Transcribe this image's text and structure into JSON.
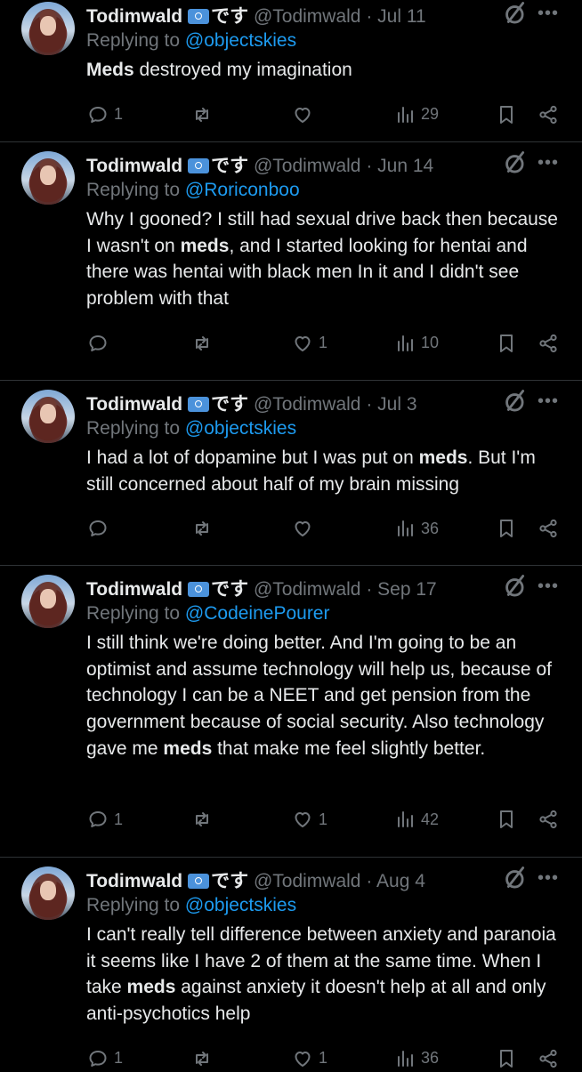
{
  "tweets": [
    {
      "name": "Todimwald",
      "desu": "です",
      "handle": "@Todimwald",
      "date": "Jul 11",
      "replying_label": "Replying to",
      "replying_to": "@objectskies",
      "segments": [
        "",
        "Meds",
        " destroyed my imagination"
      ],
      "replies": "1",
      "retweets": "",
      "likes": "",
      "views": "29"
    },
    {
      "name": "Todimwald",
      "desu": "です",
      "handle": "@Todimwald",
      "date": "Jun 14",
      "replying_label": "Replying to",
      "replying_to": "@Roriconboo",
      "segments": [
        "Why I gooned? I still had sexual drive back then because I wasn't on ",
        "meds",
        ", and I started looking for hentai and there was hentai with black men In it and I didn't see problem with that"
      ],
      "replies": "",
      "retweets": "",
      "likes": "1",
      "views": "10"
    },
    {
      "name": "Todimwald",
      "desu": "です",
      "handle": "@Todimwald",
      "date": "Jul 3",
      "replying_label": "Replying to",
      "replying_to": "@objectskies",
      "segments": [
        "I had a lot of dopamine but I was put on ",
        "meds",
        ". But I'm still concerned about half of my brain missing"
      ],
      "replies": "",
      "retweets": "",
      "likes": "",
      "views": "36"
    },
    {
      "name": "Todimwald",
      "desu": "です",
      "handle": "@Todimwald",
      "date": "Sep 17",
      "replying_label": "Replying to",
      "replying_to": "@CodeinePourer",
      "segments": [
        "I still think we're doing better. And I'm going to be an optimist and assume technology will help us, because of technology I can be a NEET and get pension from the government because of social security. Also technology gave me ",
        "meds",
        " that make me feel slightly better."
      ],
      "replies": "1",
      "retweets": "",
      "likes": "1",
      "views": "42"
    },
    {
      "name": "Todimwald",
      "desu": "です",
      "handle": "@Todimwald",
      "date": "Aug 4",
      "replying_label": "Replying to",
      "replying_to": "@objectskies",
      "segments": [
        "I can't really tell difference between anxiety and paranoia it seems like I have 2 of them at the same time. When I take ",
        "meds",
        " against anxiety it doesn't help at all and only anti-psychotics help"
      ],
      "replies": "1",
      "retweets": "",
      "likes": "1",
      "views": "36"
    }
  ],
  "more_glyph": "•••",
  "separator": "·",
  "icons": {
    "reply": "reply-icon",
    "retweet": "retweet-icon",
    "like": "heart-icon",
    "views": "views-icon",
    "bookmark": "bookmark-icon",
    "share": "share-icon",
    "grok": "grok-icon",
    "flag": "un-flag-icon"
  },
  "colors": {
    "bg": "#000000",
    "text": "#e7e9ea",
    "muted": "#71767b",
    "link": "#1d9bf0",
    "divider": "#2f3336"
  }
}
